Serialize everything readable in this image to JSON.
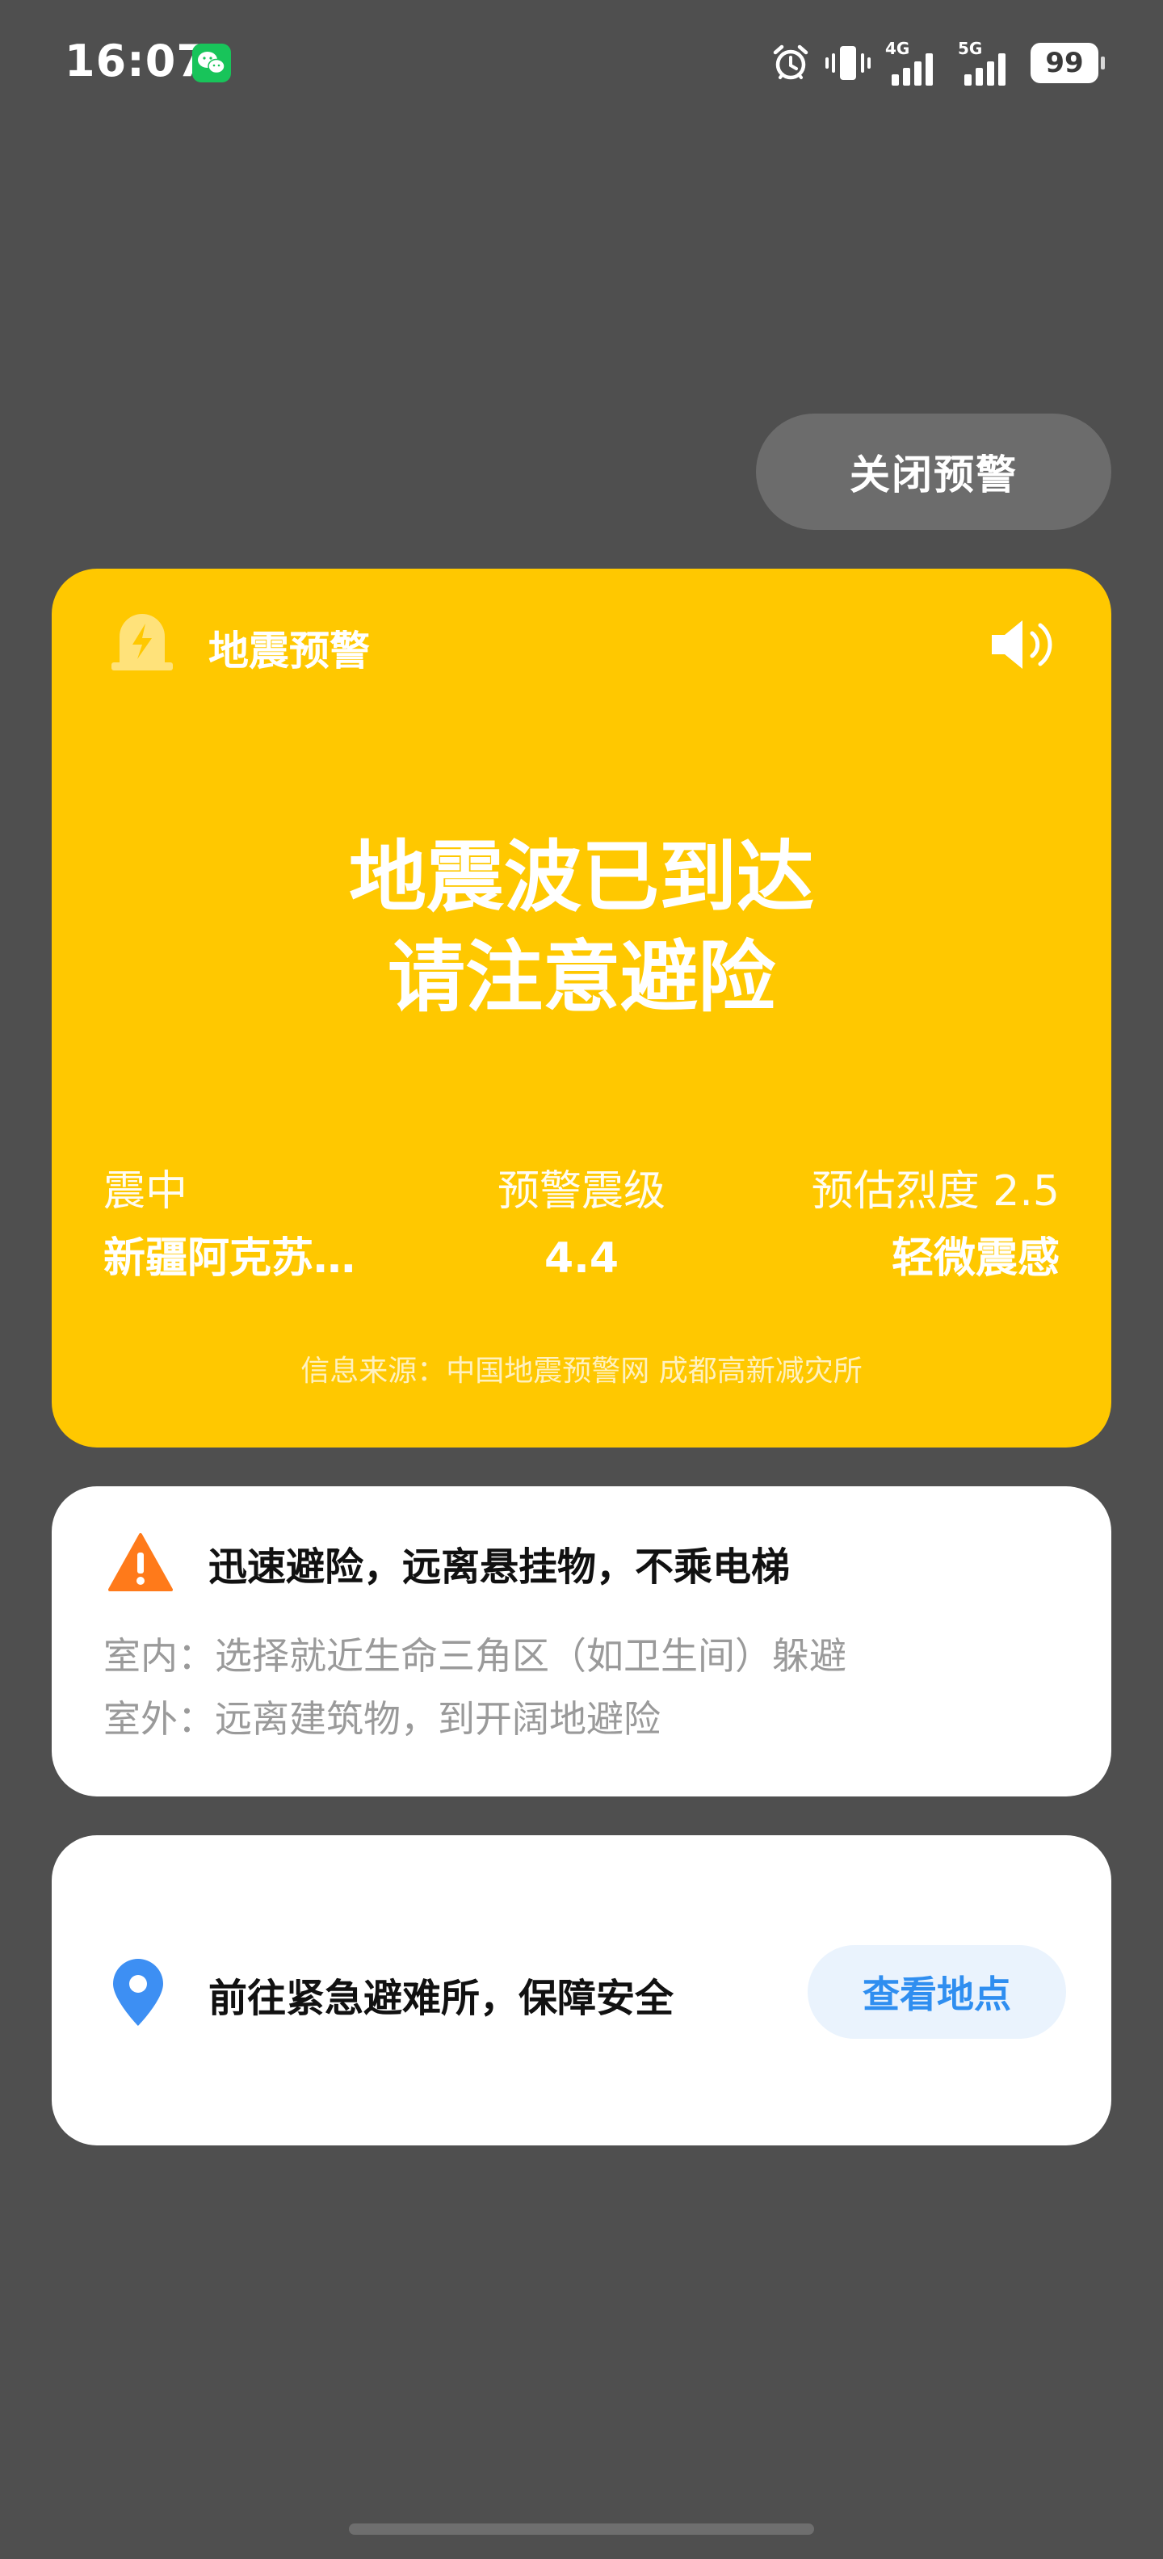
{
  "status_bar": {
    "time": "16:07",
    "net1": "4G",
    "net2": "5G",
    "battery": "99",
    "icons": [
      "wechat-icon",
      "alarm-icon",
      "vibrate-icon",
      "signal-icon",
      "battery-icon"
    ]
  },
  "close_button": {
    "label": "关闭预警"
  },
  "alert": {
    "title": "地震预警",
    "headline_line1": "地震波已到达",
    "headline_line2": "请注意避险",
    "epicenter_label": "震中",
    "epicenter_value": "新疆阿克苏…",
    "magnitude_label": "预警震级",
    "magnitude_value": "4.4",
    "intensity_label": "预估烈度 2.5",
    "intensity_value": "轻微震感",
    "source": "信息来源：中国地震预警网 成都高新减灾所",
    "bg_color": "#ffc800"
  },
  "tips": {
    "title": "迅速避险，远离悬挂物，不乘电梯",
    "indoor": "室内：选择就近生命三角区（如卫生间）躲避",
    "outdoor": "室外：远离建筑物，到开阔地避险"
  },
  "shelter": {
    "text": "前往紧急避难所，保障安全",
    "button_label": "查看地点",
    "accent_color": "#2f8ef0"
  }
}
